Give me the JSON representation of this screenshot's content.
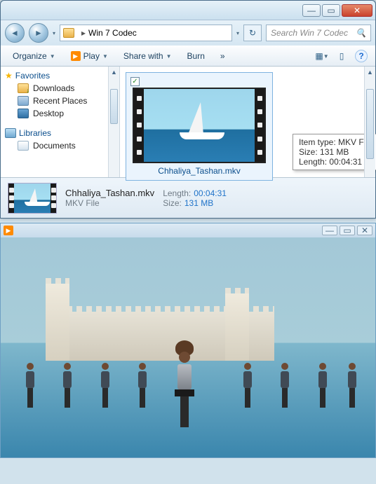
{
  "titlebar": {
    "min": "—",
    "max": "▭",
    "close": "✕"
  },
  "nav": {
    "back": "◄",
    "fwd": "►",
    "dd": "▾",
    "path_sep": "▸",
    "folder": "Win 7 Codec",
    "refresh": "↻",
    "search_placeholder": "Search Win 7 Codec",
    "mag": "🔍"
  },
  "toolbar": {
    "organize": "Organize",
    "play": "Play",
    "share": "Share with",
    "burn": "Burn",
    "more": "»",
    "view": "▦",
    "preview": "▯",
    "help": "?"
  },
  "tree": {
    "favorites": "Favorites",
    "downloads": "Downloads",
    "recent": "Recent Places",
    "desktop": "Desktop",
    "libraries": "Libraries",
    "documents": "Documents"
  },
  "item": {
    "checked": "✓",
    "filename": "Chhaliya_Tashan.mkv"
  },
  "tooltip": {
    "l1_lbl": "Item type:",
    "l1_val": "MKV File",
    "l2_lbl": "Size:",
    "l2_val": "131 MB",
    "l3_lbl": "Length:",
    "l3_val": "00:04:31"
  },
  "details": {
    "name": "Chhaliya_Tashan.mkv",
    "type": "MKV File",
    "length_lbl": "Length:",
    "length_val": "00:04:31",
    "size_lbl": "Size:",
    "size_val": "131 MB"
  },
  "player": {
    "play": "▶",
    "min": "—",
    "max": "▭",
    "close": "✕"
  }
}
